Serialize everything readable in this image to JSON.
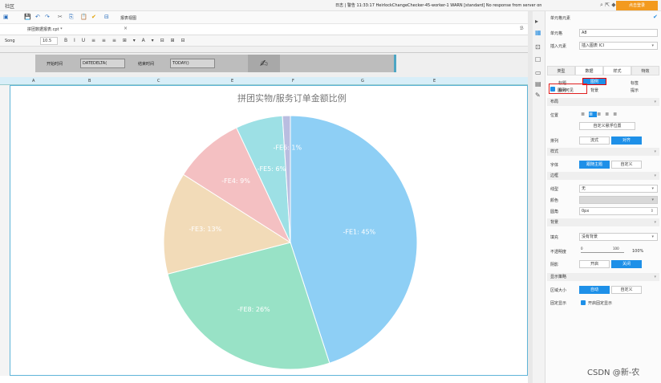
{
  "topbar": {
    "title": "社区",
    "log": "日志 | 警告 11:33:17 HeirlockChangeChecker-45-worker-1 WARN [standard] No response from server on",
    "login": "点击登录"
  },
  "toolbar": {
    "view_label": "报表视图"
  },
  "tab": {
    "label": "拼团数据报表.cpt *",
    "close": "×",
    "edge": "ℬ"
  },
  "format": {
    "font": "Song",
    "size": "10.5",
    "buttons": "B I U ≡ ≡ ≡ ⊞ ▾ A ▾ ⊟ ⊞ ⊟"
  },
  "params": {
    "start_label": "开始时间",
    "start_formula": "DATEDELTA(",
    "end_label": "结束时间",
    "end_formula": "TODAY()",
    "pen": "✍"
  },
  "columns": [
    "A",
    "B",
    "C",
    "E",
    "F",
    "G",
    "E"
  ],
  "chart_data": {
    "type": "pie",
    "title": "拼团实物/服务订单金额比例",
    "series": [
      {
        "label": "-FE1: 45%",
        "value": 45,
        "color": "#8ecff5"
      },
      {
        "label": "-FE8: 26%",
        "value": 26,
        "color": "#98e2c6"
      },
      {
        "label": "-FE3: 13%",
        "value": 13,
        "color": "#f2dbb8"
      },
      {
        "label": "-FE4: 9%",
        "value": 9,
        "color": "#f4c0c2"
      },
      {
        "label": "-FE5: 6%",
        "value": 6,
        "color": "#9de0e5"
      },
      {
        "label": "-FE6: 1%",
        "value": 1,
        "color": "#b9bde0"
      }
    ],
    "labels_shown": [
      "-FE1: 45%",
      "-FE8: 26%",
      "-FE3: 13%",
      "-FE4: 9%",
      "-FE5: 6%",
      "-FE6: 1%"
    ]
  },
  "panel": {
    "header": "单元格元素",
    "cell_label": "单元格",
    "cell_value": "A8",
    "insert_label": "插入元素",
    "insert_value": "插入图表 ICI",
    "tabs": [
      "类型",
      "数据",
      "样式",
      "特效"
    ],
    "subtabs": [
      "标题",
      "图例",
      "标签",
      "系列",
      "背景",
      "提示"
    ],
    "legend_visible": "图例可见",
    "layout_section": "布局",
    "position_label": "位置",
    "custom_pos": "自定义悬浮位置",
    "arrange_label": "排列",
    "arrange_opts": [
      "流式",
      "对齐"
    ],
    "style_section": "样式",
    "font_label": "字体",
    "font_opts": [
      "跟随主题",
      "自定义"
    ],
    "border_section": "边框",
    "line_label": "线型",
    "line_value": "无",
    "color_label": "颜色",
    "radius_label": "圆角",
    "radius_value": "0px",
    "bg_section": "背景",
    "fill_label": "填充",
    "fill_value": "没有背景",
    "opacity_label": "不透明度",
    "opacity_min": "0",
    "opacity_max": "100",
    "opacity_value": "100%",
    "shadow_label": "阴影",
    "shadow_opts": [
      "开启",
      "关闭"
    ],
    "display_section": "显示策略",
    "area_label": "区域大小",
    "area_opts": [
      "自动",
      "自定义"
    ],
    "fixed_label": "固定显示",
    "fixed_opt": "开启固定显示"
  },
  "watermark": "CSDN @新-农"
}
